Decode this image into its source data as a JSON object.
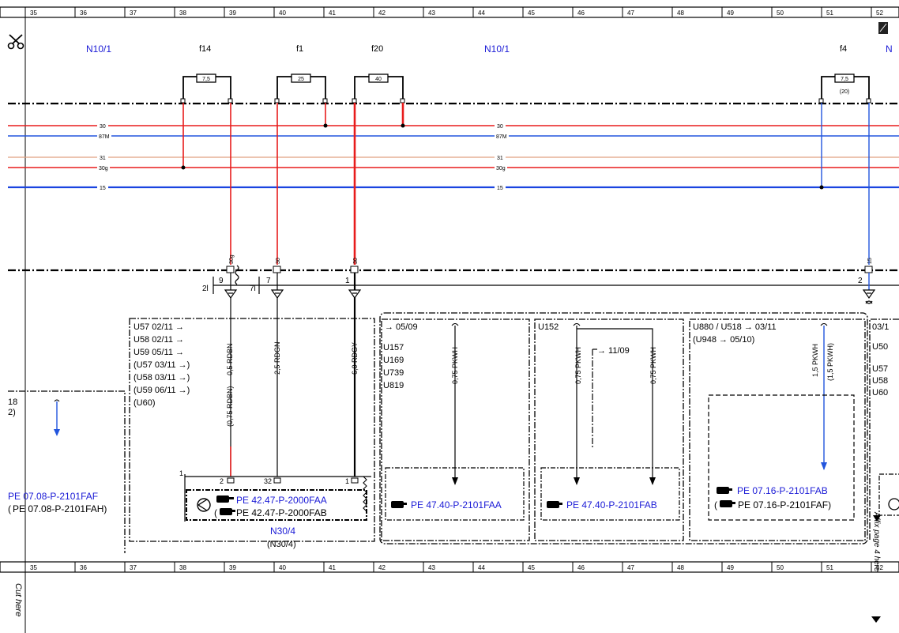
{
  "ruler": {
    "columns": [
      "35",
      "36",
      "37",
      "38",
      "39",
      "40",
      "41",
      "42",
      "43",
      "44",
      "45",
      "46",
      "47",
      "48",
      "49",
      "50",
      "51",
      "52"
    ]
  },
  "cut_hint": "Cut here",
  "affix_hint": "Affix page 4 here",
  "components": {
    "n10_1_left": "N10/1",
    "n10_1_mid": "N10/1",
    "n10_1_right": "N",
    "n30_4": "N30/4",
    "n30_4_alt": "(N30/4)"
  },
  "fuses": [
    {
      "name": "f14",
      "rating": "7,5",
      "extra": ""
    },
    {
      "name": "f1",
      "rating": "25",
      "extra": ""
    },
    {
      "name": "f20",
      "rating": "40",
      "extra": ""
    },
    {
      "name": "f4",
      "rating": "7,5",
      "extra": "(20)"
    }
  ],
  "bus_lines": [
    {
      "label": "30",
      "color": "#e81c1c"
    },
    {
      "label": "87M",
      "color": "#2255dd"
    },
    {
      "label": "31",
      "color": "#e0a080"
    },
    {
      "label": "30g",
      "color": "#e81c1c"
    },
    {
      "label": "15",
      "color": "#2255dd"
    }
  ],
  "pins": {
    "p30g": "30g",
    "p30a": "30",
    "p30b": "30",
    "p15": "15",
    "n9": "9",
    "n7": "7",
    "n1": "1",
    "n2": "2",
    "n2l": "2l",
    "n7l": "7l"
  },
  "wires": {
    "w1": "0,5 RDBN",
    "w1alt": "(0,75 RDBN)",
    "w2": "2,5 RDGN",
    "w3": "6,0 RDGY",
    "w4": "0,75 PKWH",
    "w5": "0,75 PKWH",
    "w6": "0,75 PKWH",
    "w7": "1,5 PKWH",
    "w7alt": "(1,5 PKWH)"
  },
  "box_n30": {
    "lines": [
      "U57  02/11 →",
      "U58  02/11 →",
      "U59  05/11 →",
      "(U57  03/11 →)",
      "(U58  03/11 →)",
      "(U59  06/11 →)",
      "(U60)"
    ],
    "pin_a": "1",
    "pin_b": "2",
    "pin_c": "32",
    "pin_d": "1",
    "ref1": "PE 42.47-P-2000FAA",
    "ref2": "PE 42.47-P-2000FAB"
  },
  "box_left": {
    "lines": [
      "18",
      "2)"
    ],
    "ref1": "PE 07.08-P-2101FAF",
    "ref2": "PE 07.08-P-2101FAH)"
  },
  "box_b": {
    "line1": "→ 05/09",
    "codes": [
      "U157",
      "U169",
      "U739",
      "U819"
    ],
    "ref": "PE 47.40-P-2101FAA"
  },
  "box_c": {
    "line1": "U152",
    "arrow_text": "→ 11/09",
    "ref": "PE 47.40-P-2101FAB"
  },
  "box_d": {
    "line1": "U880 / U518 → 03/11",
    "line2": "(U948 → 05/10)",
    "ref1": "PE 07.16-P-2101FAB",
    "ref2": "PE 07.16-P-2101FAF)"
  },
  "box_e": {
    "lines": [
      "03/1",
      "U50",
      "U57",
      "U58",
      "U60"
    ]
  },
  "colors": {
    "red": "#e81c1c",
    "blue": "#2255dd",
    "bus_blue": "#1a44e0",
    "label_blue": "#1a1ad6"
  }
}
